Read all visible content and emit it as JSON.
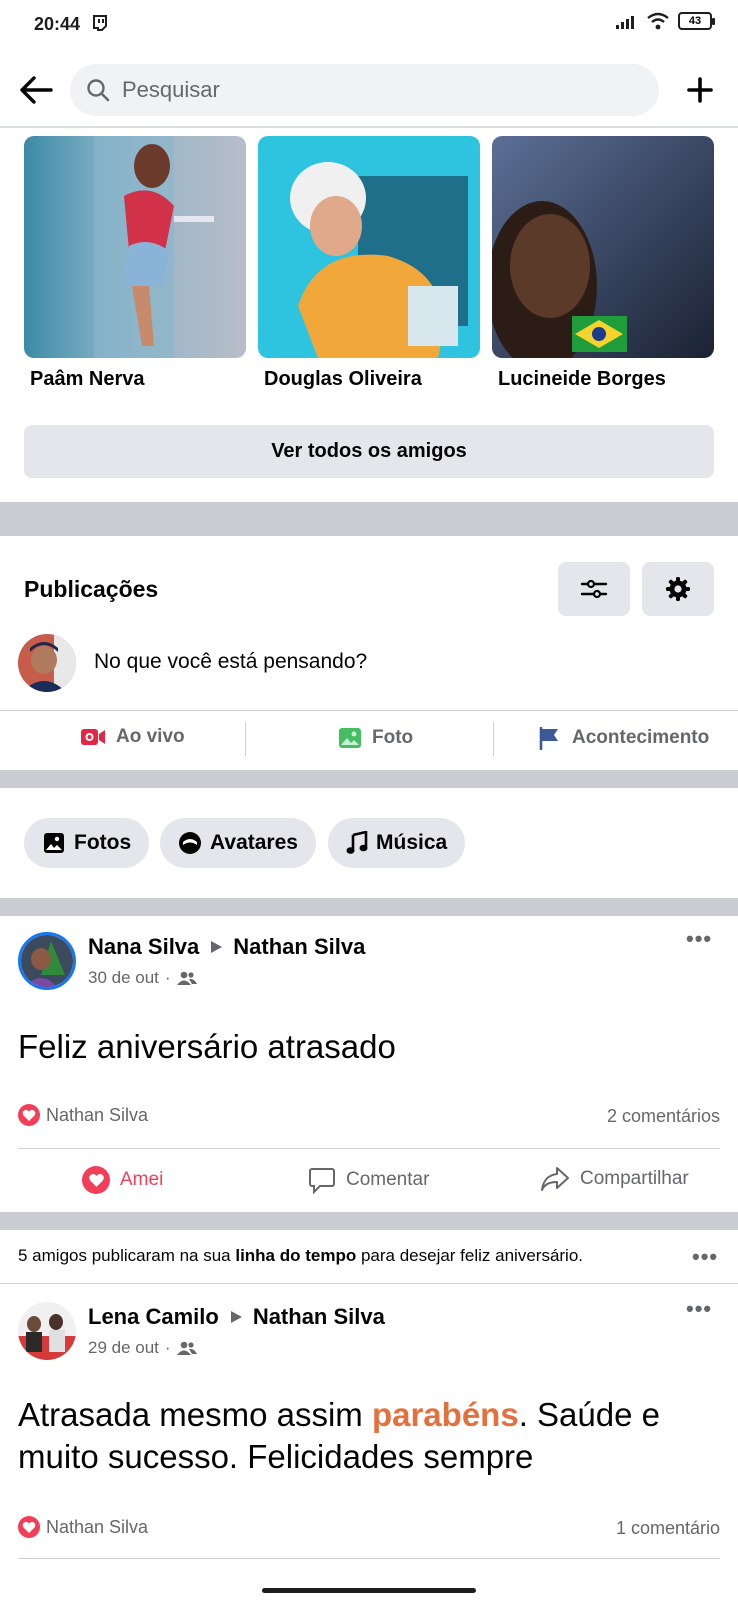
{
  "status_bar": {
    "time": "20:44",
    "battery": "43"
  },
  "search": {
    "placeholder": "Pesquisar"
  },
  "friends": [
    {
      "name": "Paâm Nerva"
    },
    {
      "name": "Douglas Oliveira"
    },
    {
      "name": "Lucineide Borges"
    }
  ],
  "see_all_friends_label": "Ver todos os amigos",
  "publications": {
    "title": "Publicações",
    "composer_placeholder": "No que você está pensando?",
    "actions": {
      "live": "Ao vivo",
      "photo": "Foto",
      "event": "Acontecimento"
    },
    "chips": {
      "photos": "Fotos",
      "avatars": "Avatares",
      "music": "Música"
    }
  },
  "posts": [
    {
      "author": "Nana Silva",
      "target": "Nathan Silva",
      "date": "30 de out",
      "text": "Feliz aniversário atrasado",
      "reacted_by": "Nathan Silva",
      "comments": "2 comentários",
      "actions": {
        "love": "Amei",
        "comment": "Comentar",
        "share": "Compartilhar"
      }
    },
    {
      "author": "Lena Camilo",
      "target": "Nathan Silva",
      "date": "29 de out",
      "text_before": "Atrasada mesmo assim ",
      "text_highlight": "parabéns",
      "text_after": ". Saúde e muito sucesso. Felicidades sempre",
      "reacted_by": "Nathan Silva",
      "comments": "1 comentário"
    }
  ],
  "birthday_notice": {
    "prefix": "5 amigos publicaram na sua ",
    "bold": "linha do tempo",
    "suffix": " para desejar feliz aniversário."
  },
  "colors": {
    "accent": "#1877f2",
    "love": "#f33e58",
    "highlight": "#e4703e"
  }
}
